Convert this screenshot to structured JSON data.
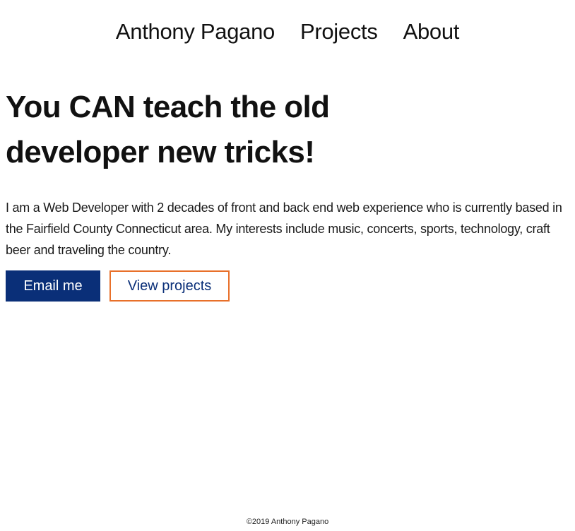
{
  "nav": {
    "brand": "Anthony Pagano",
    "projects": "Projects",
    "about": "About"
  },
  "hero": {
    "title": "You CAN teach the old developer new tricks!",
    "intro": "I am a Web Developer with 2 decades of front and back end web experience who is currently based in the Fairfield County Connecticut area. My interests include music, concerts, sports, technology, craft beer and traveling the country."
  },
  "actions": {
    "email_label": "Email me",
    "projects_label": "View projects"
  },
  "footer": {
    "copyright": "©2019 Anthony Pagano"
  },
  "colors": {
    "primary": "#0a2f78",
    "accent": "#e8702a",
    "text": "#111111",
    "background": "#ffffff"
  }
}
